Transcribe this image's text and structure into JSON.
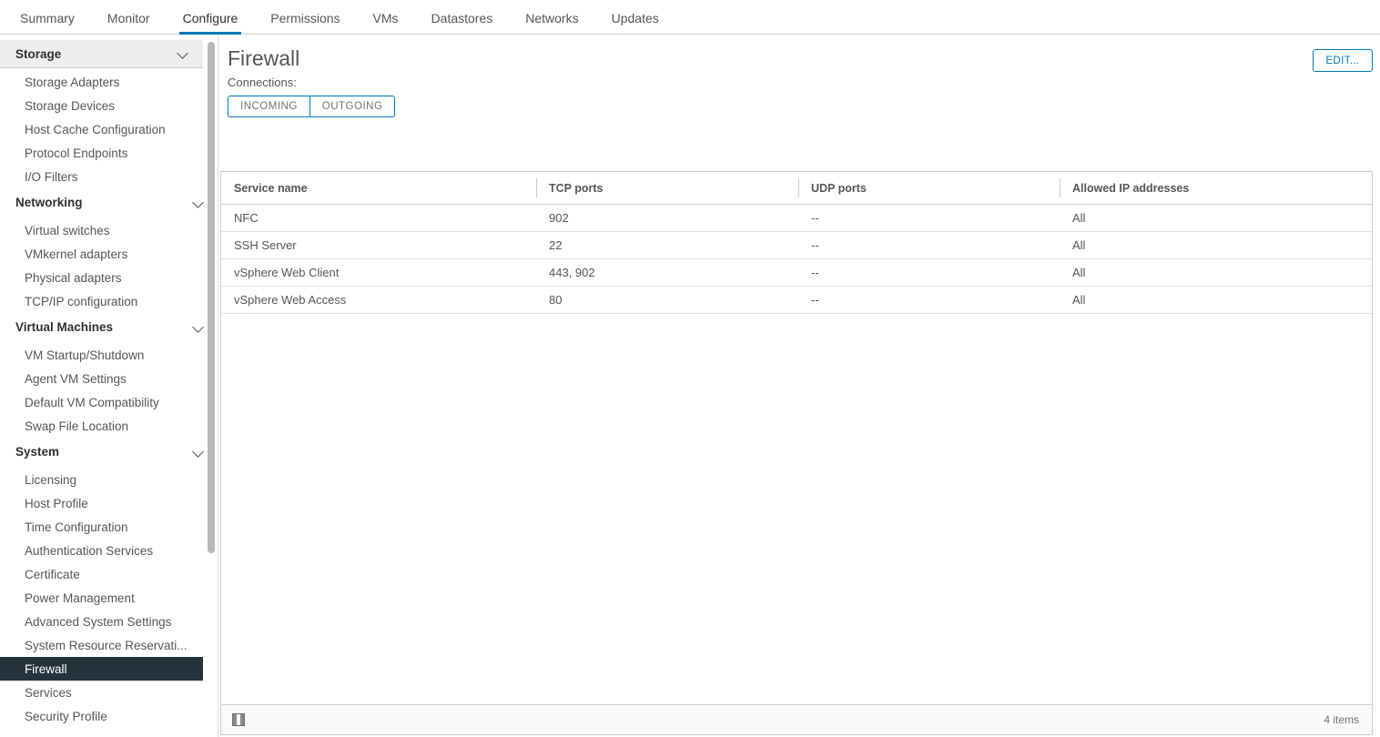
{
  "tabs": [
    {
      "label": "Summary",
      "active": false
    },
    {
      "label": "Monitor",
      "active": false
    },
    {
      "label": "Configure",
      "active": true
    },
    {
      "label": "Permissions",
      "active": false
    },
    {
      "label": "VMs",
      "active": false
    },
    {
      "label": "Datastores",
      "active": false
    },
    {
      "label": "Networks",
      "active": false
    },
    {
      "label": "Updates",
      "active": false
    }
  ],
  "sidebar": {
    "groups": [
      {
        "label": "Storage",
        "chevron_icon": "chevron-down-icon",
        "shaded": true,
        "items": [
          {
            "label": "Storage Adapters",
            "selected": false
          },
          {
            "label": "Storage Devices",
            "selected": false
          },
          {
            "label": "Host Cache Configuration",
            "selected": false
          },
          {
            "label": "Protocol Endpoints",
            "selected": false
          },
          {
            "label": "I/O Filters",
            "selected": false
          }
        ]
      },
      {
        "label": "Networking",
        "chevron_icon": "chevron-down-icon",
        "shaded": false,
        "items": [
          {
            "label": "Virtual switches",
            "selected": false
          },
          {
            "label": "VMkernel adapters",
            "selected": false
          },
          {
            "label": "Physical adapters",
            "selected": false
          },
          {
            "label": "TCP/IP configuration",
            "selected": false
          }
        ]
      },
      {
        "label": "Virtual Machines",
        "chevron_icon": "chevron-down-icon",
        "shaded": false,
        "items": [
          {
            "label": "VM Startup/Shutdown",
            "selected": false
          },
          {
            "label": "Agent VM Settings",
            "selected": false
          },
          {
            "label": "Default VM Compatibility",
            "selected": false
          },
          {
            "label": "Swap File Location",
            "selected": false
          }
        ]
      },
      {
        "label": "System",
        "chevron_icon": "chevron-down-icon",
        "shaded": false,
        "items": [
          {
            "label": "Licensing",
            "selected": false
          },
          {
            "label": "Host Profile",
            "selected": false
          },
          {
            "label": "Time Configuration",
            "selected": false
          },
          {
            "label": "Authentication Services",
            "selected": false
          },
          {
            "label": "Certificate",
            "selected": false
          },
          {
            "label": "Power Management",
            "selected": false
          },
          {
            "label": "Advanced System Settings",
            "selected": false
          },
          {
            "label": "System Resource Reservati...",
            "selected": false
          },
          {
            "label": "Firewall",
            "selected": true
          },
          {
            "label": "Services",
            "selected": false
          },
          {
            "label": "Security Profile",
            "selected": false
          }
        ]
      }
    ],
    "scrollbar": "vertical-scrollbar"
  },
  "main": {
    "title": "Firewall",
    "edit_button": "EDIT...",
    "connections_label": "Connections:",
    "connection_toggles": [
      {
        "label": "INCOMING",
        "selected": true
      },
      {
        "label": "OUTGOING",
        "selected": false
      }
    ],
    "table": {
      "columns": [
        "Service name",
        "TCP ports",
        "UDP ports",
        "Allowed IP addresses"
      ],
      "rows": [
        {
          "service": "NFC",
          "tcp": "902",
          "udp": "--",
          "ips": "All"
        },
        {
          "service": "SSH Server",
          "tcp": "22",
          "udp": "--",
          "ips": "All"
        },
        {
          "service": "vSphere Web Client",
          "tcp": "443, 902",
          "udp": "--",
          "ips": "All"
        },
        {
          "service": "vSphere Web Access",
          "tcp": "80",
          "udp": "--",
          "ips": "All"
        }
      ]
    },
    "footer": {
      "split_view_icon": "split-panel-icon",
      "item_count": "4 items"
    }
  },
  "colors": {
    "accent": "#0079b8",
    "selected_nav_bg": "#25333d",
    "text": "#565656",
    "border": "#cccccc"
  }
}
